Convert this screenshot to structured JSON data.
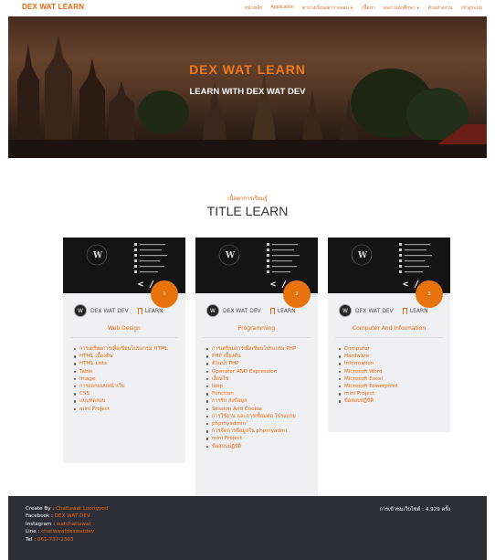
{
  "nav": {
    "brand": "DEX WAT LEARN",
    "items": [
      {
        "label": "หน้าหลัก",
        "dropdown": false
      },
      {
        "label": "Application",
        "dropdown": false
      },
      {
        "label": "ตารางเรียน/ตารางสอน",
        "dropdown": true
      },
      {
        "label": "เนื้อหา",
        "dropdown": false
      },
      {
        "label": "ผลงานนักศึกษา",
        "dropdown": true
      },
      {
        "label": "ตัวอย่างงาน",
        "dropdown": false
      },
      {
        "label": "เข้าสู่ระบบ",
        "dropdown": false
      }
    ]
  },
  "hero": {
    "title": "DEX WAT LEARN",
    "subtitle": "LEARN WITH DEX WAT DEV"
  },
  "section": {
    "kicker": "เนื้อหาการเรียนรู้",
    "title": "TITLE LEARN"
  },
  "cards": [
    {
      "badge": "1",
      "author": "DEX WAT DEV",
      "learn_label": "LEARN",
      "category": "Web Design",
      "topics": [
        "การเตรียมการเพื่อเขียนโปรแกรม HTML",
        "HTML เบื้องต้น",
        "HTML Lists",
        "Table",
        "Image",
        "การออกแบบหน้าเว็บ",
        "CSS",
        "แบบทดสอบ",
        "mini Project"
      ]
    },
    {
      "badge": "2",
      "author": "DEX WAT DEV",
      "learn_label": "LEARN",
      "category": "Programming",
      "topics": [
        "การเตรียมการเพื่อเขียนโปรแกรม PHP",
        "PHP เบื้องต้น",
        "ตัวแปร PHP",
        "Operator AND Expression",
        "เงื่อนไข",
        "loop",
        "Function",
        "การรับ ส่งข้อมูล",
        "Session And Cookie",
        "การใช้งาน และการเชื่อมต่อ โปรแกรม",
        "phpmyadmin",
        "การจัดการข้อมูลใน phpmyadmi",
        "mini Project",
        "ข้อสอบปฏิบัติ"
      ]
    },
    {
      "badge": "3",
      "author": "DEX WAT DEV",
      "learn_label": "LEARN",
      "category": "Computer And Information",
      "topics": [
        "Computer",
        "Hardware",
        "Information",
        "Microsoft Word",
        "Microsoft Excel",
        "Microsoft Powerpoint",
        "mini Project",
        "ข้อสอบปฏิบัติ"
      ]
    }
  ],
  "footer": {
    "created_label": "Create By : ",
    "created": "Chatlawat Loongyod",
    "facebook_label": "Facebook : ",
    "facebook": "DEX WAT DEV",
    "instagram_label": "Instagram : ",
    "instagram": "watchatlawat",
    "line_label": "Line : ",
    "line": "chatlawatdexwatdev",
    "tel_label": "Tel : ",
    "tel": "061-737-2303",
    "visits": "การเข้าชมเว็บไซต์ : 4,929 ครั้ง"
  },
  "colors": {
    "accent": "#e8670f",
    "footer_bg": "#2d2e36",
    "card_bg": "#f0f0f2"
  }
}
